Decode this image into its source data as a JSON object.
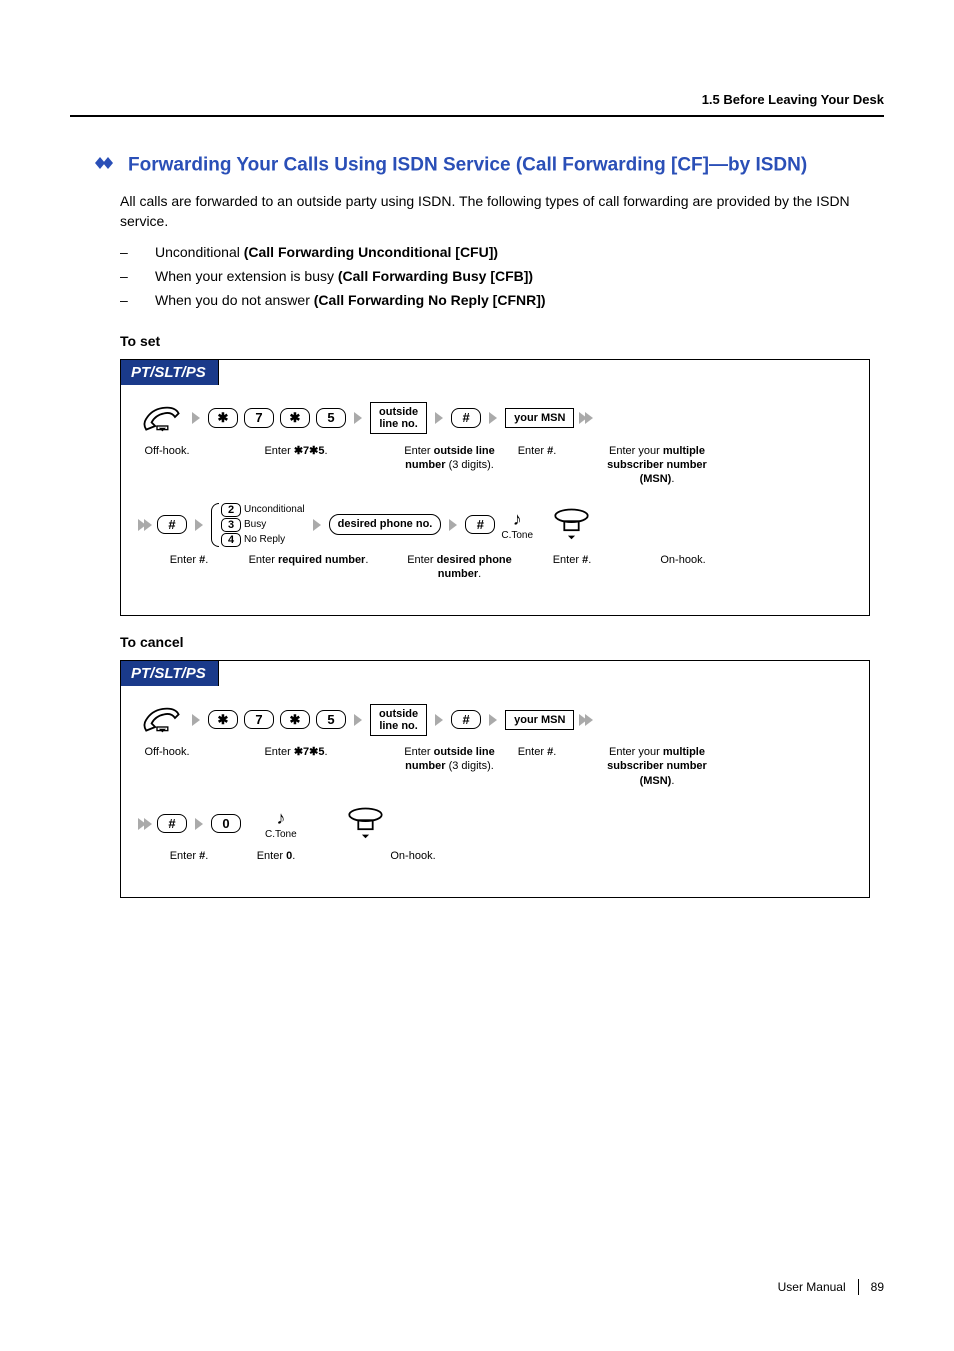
{
  "header": {
    "section": "1.5 Before Leaving Your Desk"
  },
  "heading": "Forwarding Your Calls Using ISDN Service (Call Forwarding [CF]—by ISDN)",
  "intro": "All calls are forwarded to an outside party using ISDN. The following types of call forwarding are provided by the ISDN service.",
  "bullets": [
    {
      "text": "Unconditional ",
      "bold": "(Call Forwarding Unconditional [CFU])"
    },
    {
      "text": "When your extension is busy ",
      "bold": "(Call Forwarding Busy [CFB])"
    },
    {
      "text": "When you do not answer ",
      "bold": "(Call Forwarding No Reply [CFNR])"
    }
  ],
  "set": {
    "label": "To set",
    "tab": "PT/SLT/PS",
    "keys": {
      "star": "✱",
      "seven": "7",
      "five": "5",
      "hash": "#",
      "zero": "0"
    },
    "options": [
      {
        "key": "2",
        "label": "Unconditional"
      },
      {
        "key": "3",
        "label": "Busy"
      },
      {
        "key": "4",
        "label": "No Reply"
      }
    ],
    "boxes": {
      "outside": "outside\nline no.",
      "msn": "your MSN",
      "desired": "desired phone no."
    },
    "captions": {
      "offhook": "Off-hook.",
      "enter75": "Enter ✱7✱5.",
      "enterOutside": "Enter outside line number (3 digits).",
      "enterHash": "Enter #.",
      "enterMSN": "Enter your multiple subscriber number (MSN).",
      "enterRequired": "Enter required number.",
      "enterDesired": "Enter desired phone number.",
      "onhook": "On-hook.",
      "ctone": "C.Tone",
      "enter0": "Enter 0."
    }
  },
  "cancel": {
    "label": "To cancel",
    "tab": "PT/SLT/PS"
  },
  "footer": {
    "manual": "User Manual",
    "page": "89"
  }
}
